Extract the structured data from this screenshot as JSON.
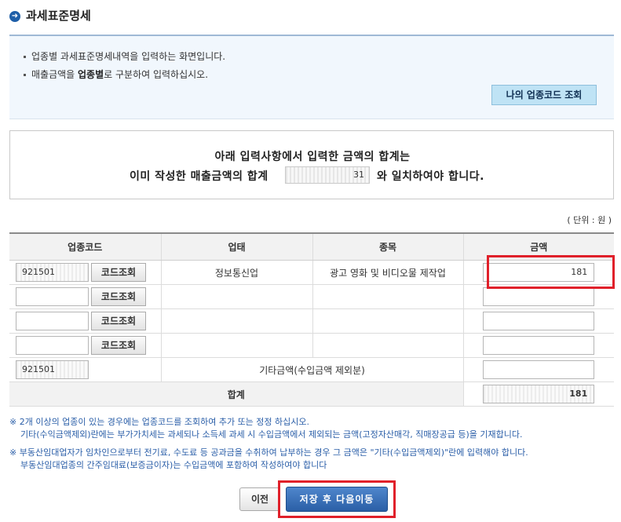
{
  "page": {
    "title": "과세표준명세"
  },
  "info": {
    "line1": "업종별 과세표준명세내역을 입력하는 화면입니다.",
    "line2_pre": "매출금액을 ",
    "line2_bold": "업종별",
    "line2_post": "로 구분하여 입력하십시오.",
    "my_code_button": "나의 업종코드 조회"
  },
  "notice": {
    "line1": "아래 입력사항에서  입력한 금액의 합계는",
    "line2_pre": "이미 작성한 매출금액의 합계",
    "line2_post": "와 일치하여야 합니다.",
    "sales_total": "31"
  },
  "unit_label": "( 단위 : 원 )",
  "table": {
    "headers": [
      "업종코드",
      "업태",
      "종목",
      "금액"
    ],
    "code_button": "코드조회",
    "rows": [
      {
        "code": "921501",
        "business": "정보통신업",
        "item": "광고 영화 및 비디오물 제작업",
        "amount": "181"
      },
      {
        "code": "",
        "business": "",
        "item": "",
        "amount": ""
      },
      {
        "code": "",
        "business": "",
        "item": "",
        "amount": ""
      },
      {
        "code": "",
        "business": "",
        "item": "",
        "amount": ""
      }
    ],
    "other": {
      "code": "921501",
      "label": "기타금액(수입금액 제외분)",
      "amount": ""
    },
    "total": {
      "label": "합계",
      "amount": "181"
    }
  },
  "notes": {
    "n1_line1": "※ 2개 이상의 업종이 있는 경우에는 업종코드를 조회하여 추가 또는 정정 하십시오.",
    "n1_line2": "기타(수익금액제외)란에는 부가가치세는 과세되나 소득세 과세 시 수입금액에서 제외되는 금액(고정자산매각, 직매장공급 등)을 기재합니다.",
    "n2_line1": "※ 부동산임대업자가 임차인으로부터 전기료, 수도료 등 공과금을 수취하여 납부하는 경우 그 금액은 \"기타(수입금액제외)\"란에 입력해야 합니다.",
    "n2_line2": "부동산임대업종의 간주임대료(보증금이자)는 수입금액에 포함하여 작성하여야 합니다"
  },
  "buttons": {
    "prev": "이전",
    "save_next": "저장 후 다음이동"
  },
  "colors": {
    "highlight": "#e0202a",
    "primary_button": "#2a5fa6",
    "note_text": "#2a5ea8"
  }
}
